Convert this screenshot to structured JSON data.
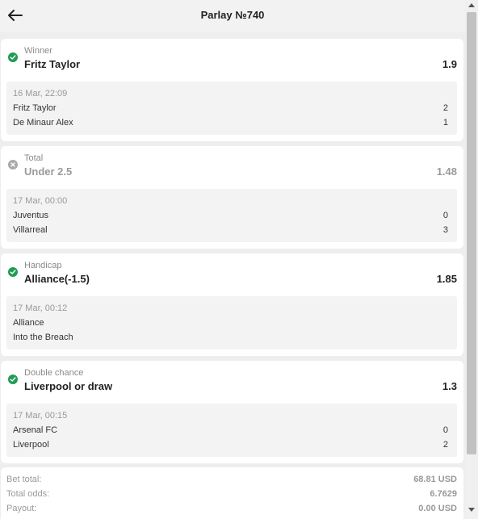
{
  "header": {
    "title": "Parlay №740"
  },
  "bets": [
    {
      "status": "won",
      "market": "Winner",
      "outcome": "Fritz Taylor",
      "odds": "1.9",
      "event": {
        "date": "16 Mar, 22:09",
        "team1": "Fritz Taylor",
        "team2": "De Minaur Alex",
        "score1": "2",
        "score2": "1"
      }
    },
    {
      "status": "lost",
      "market": "Total",
      "outcome": "Under 2.5",
      "odds": "1.48",
      "event": {
        "date": "17 Mar, 00:00",
        "team1": "Juventus",
        "team2": "Villarreal",
        "score1": "0",
        "score2": "3"
      }
    },
    {
      "status": "won",
      "market": "Handicap",
      "outcome": "Alliance(-1.5)",
      "odds": "1.85",
      "event": {
        "date": "17 Mar, 00:12",
        "team1": "Alliance",
        "team2": "Into the Breach",
        "score1": "",
        "score2": ""
      }
    },
    {
      "status": "won",
      "market": "Double chance",
      "outcome": "Liverpool or draw",
      "odds": "1.3",
      "event": {
        "date": "17 Mar, 00:15",
        "team1": "Arsenal FC",
        "team2": "Liverpool",
        "score1": "0",
        "score2": "2"
      }
    }
  ],
  "summary": {
    "bet_total_label": "Bet total:",
    "bet_total_value": "68.81 USD",
    "total_odds_label": "Total odds:",
    "total_odds_value": "6.7629",
    "payout_label": "Payout:",
    "payout_value": "0.00 USD"
  },
  "colors": {
    "won": "#1f9d55",
    "lost": "#a9a9a9"
  }
}
